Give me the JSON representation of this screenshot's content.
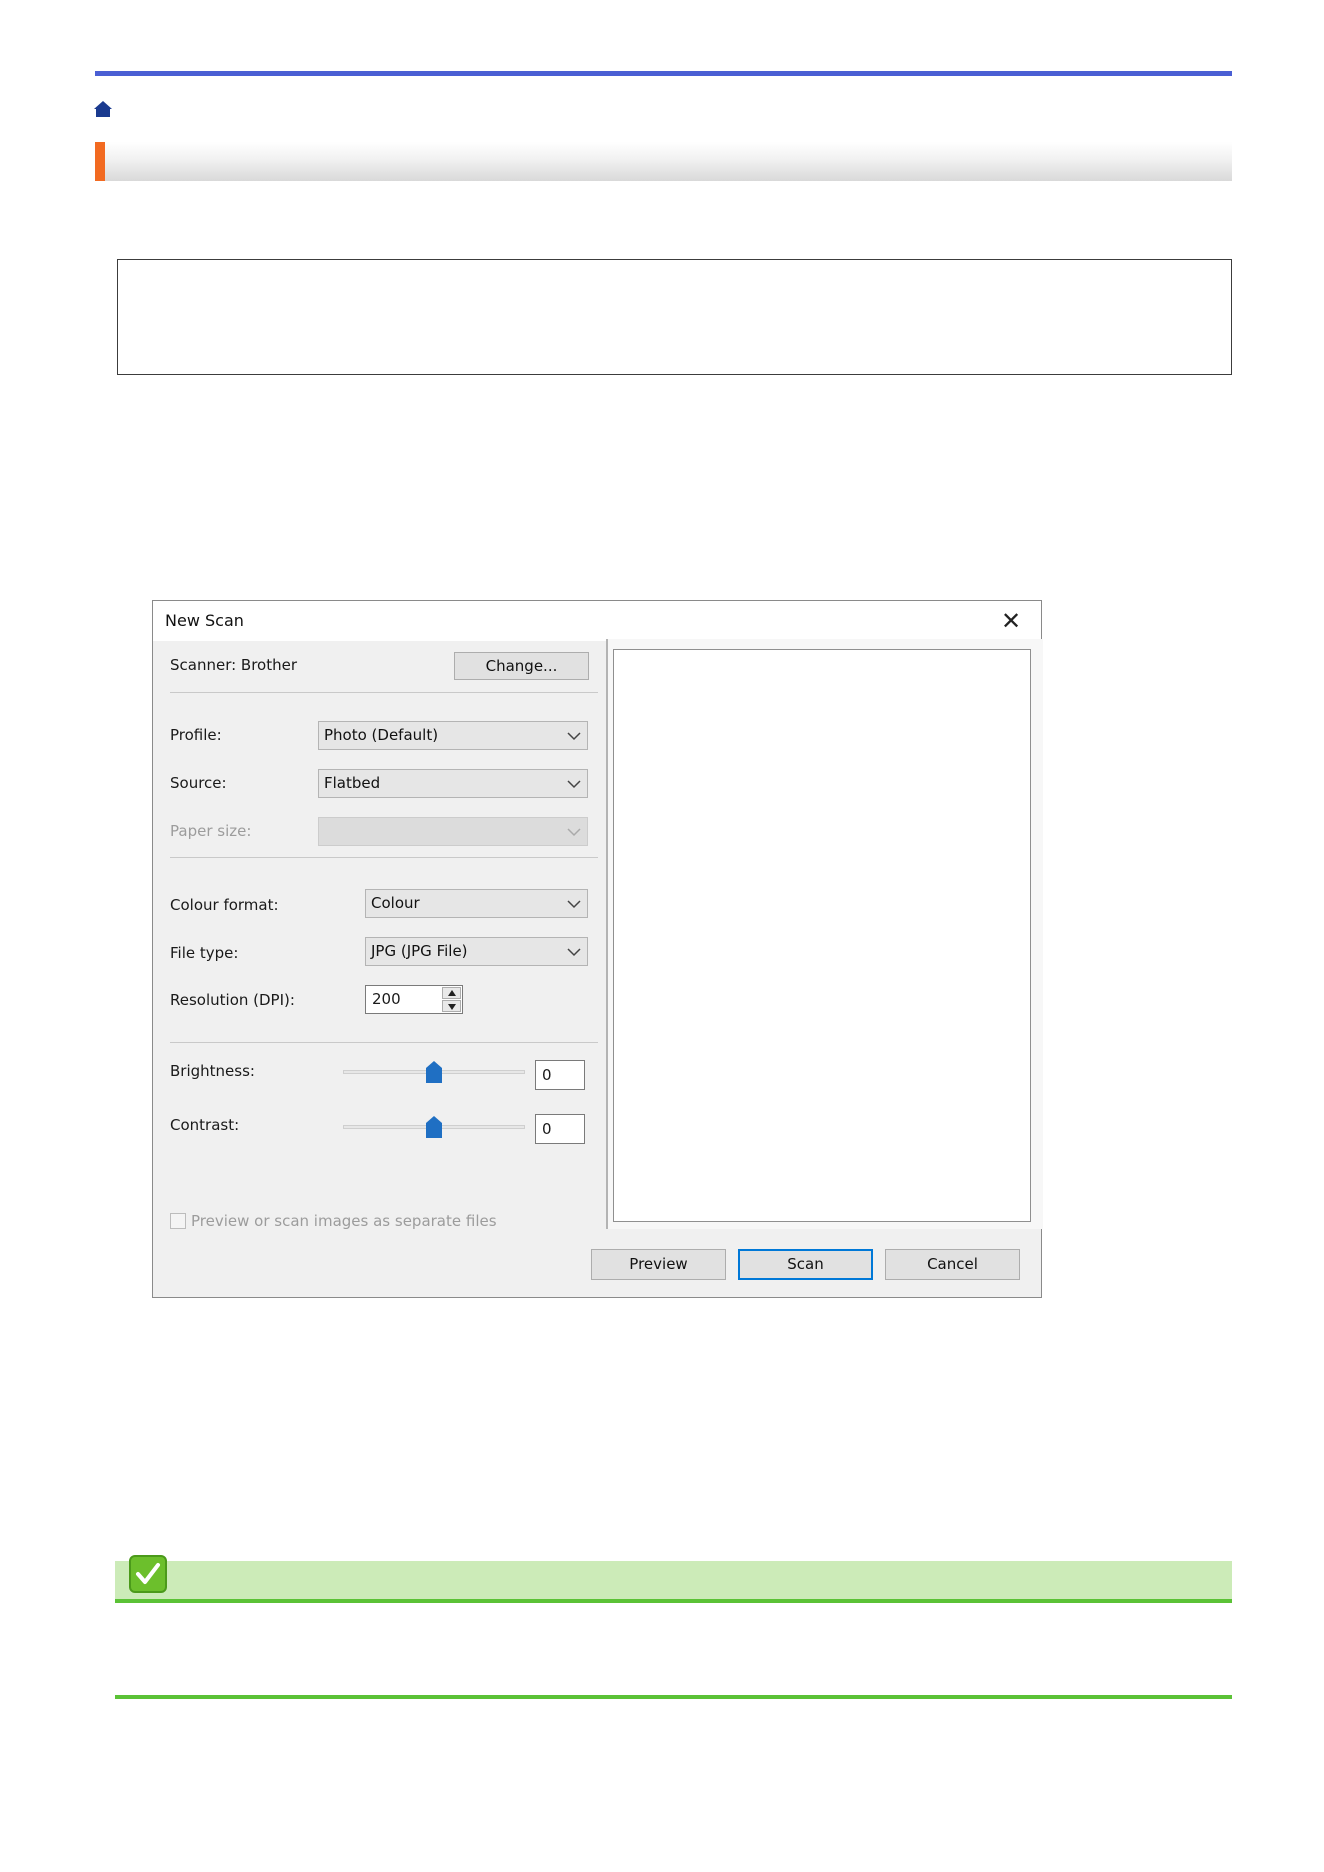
{
  "page": {
    "accent_color": "#4a5fd4",
    "section_accent_color": "#f26a21",
    "tip_color": "#5bc236",
    "icons": [
      "home-icon",
      "checkmark-icon"
    ]
  },
  "dialog": {
    "title": "New Scan",
    "close_glyph": "✕",
    "scanner_label": "Scanner: Brother",
    "change_button": "Change...",
    "profile": {
      "label": "Profile:",
      "value": "Photo (Default)"
    },
    "source": {
      "label": "Source:",
      "value": "Flatbed"
    },
    "paper_size": {
      "label": "Paper size:",
      "value": ""
    },
    "colour_format": {
      "label": "Colour format:",
      "value": "Colour"
    },
    "file_type": {
      "label": "File type:",
      "value": "JPG (JPG File)"
    },
    "resolution": {
      "label": "Resolution (DPI):",
      "value": "200"
    },
    "brightness": {
      "label": "Brightness:",
      "value": "0",
      "level": 0.5
    },
    "contrast": {
      "label": "Contrast:",
      "value": "0",
      "level": 0.5
    },
    "separate_files": {
      "label": "Preview or scan images as separate files",
      "checked": false,
      "enabled": false
    },
    "buttons": {
      "preview": "Preview",
      "scan": "Scan",
      "cancel": "Cancel"
    }
  }
}
